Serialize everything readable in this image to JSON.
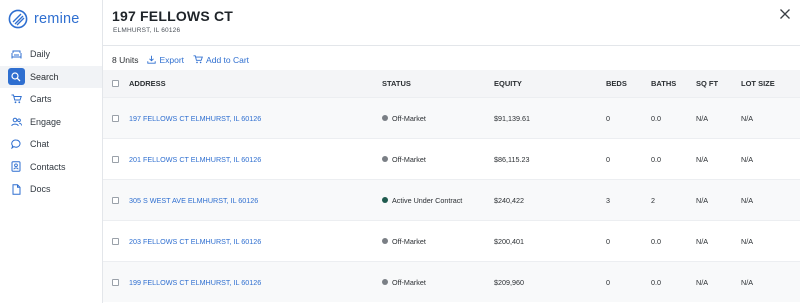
{
  "app": {
    "logo_text": "remine",
    "brand_color": "#2f6fd0"
  },
  "sidebar": {
    "items": [
      {
        "label": "Daily",
        "icon": "couch-icon",
        "active": false
      },
      {
        "label": "Search",
        "icon": "search-icon",
        "active": true
      },
      {
        "label": "Carts",
        "icon": "cart-icon",
        "active": false
      },
      {
        "label": "Engage",
        "icon": "users-icon",
        "active": false
      },
      {
        "label": "Chat",
        "icon": "chat-icon",
        "active": false
      },
      {
        "label": "Contacts",
        "icon": "contacts-icon",
        "active": false
      },
      {
        "label": "Docs",
        "icon": "document-icon",
        "active": false
      }
    ]
  },
  "panel": {
    "title": "197 FELLOWS CT",
    "subtitle": "ELMHURST, IL 60126",
    "units": "8 Units",
    "export_label": "Export",
    "add_to_cart_label": "Add to Cart"
  },
  "table": {
    "headers": {
      "address": "ADDRESS",
      "status": "STATUS",
      "equity": "EQUITY",
      "beds": "BEDS",
      "baths": "BATHS",
      "sqft": "SQ FT",
      "lot": "LOT SIZE"
    },
    "rows": [
      {
        "address": "197 FELLOWS CT ELMHURST, IL 60126",
        "status": "Off-Market",
        "status_color": "#7a7f85",
        "equity": "$91,139.61",
        "beds": "0",
        "baths": "0.0",
        "sqft": "N/A",
        "lot": "N/A"
      },
      {
        "address": "201 FELLOWS CT ELMHURST, IL 60126",
        "status": "Off-Market",
        "status_color": "#7a7f85",
        "equity": "$86,115.23",
        "beds": "0",
        "baths": "0.0",
        "sqft": "N/A",
        "lot": "N/A"
      },
      {
        "address": "305 S WEST AVE ELMHURST, IL 60126",
        "status": "Active Under Contract",
        "status_color": "#1f5a4e",
        "equity": "$240,422",
        "beds": "3",
        "baths": "2",
        "sqft": "N/A",
        "lot": "N/A"
      },
      {
        "address": "203 FELLOWS CT ELMHURST, IL 60126",
        "status": "Off-Market",
        "status_color": "#7a7f85",
        "equity": "$200,401",
        "beds": "0",
        "baths": "0.0",
        "sqft": "N/A",
        "lot": "N/A"
      },
      {
        "address": "199 FELLOWS CT ELMHURST, IL 60126",
        "status": "Off-Market",
        "status_color": "#7a7f85",
        "equity": "$209,960",
        "beds": "0",
        "baths": "0.0",
        "sqft": "N/A",
        "lot": "N/A"
      }
    ]
  }
}
